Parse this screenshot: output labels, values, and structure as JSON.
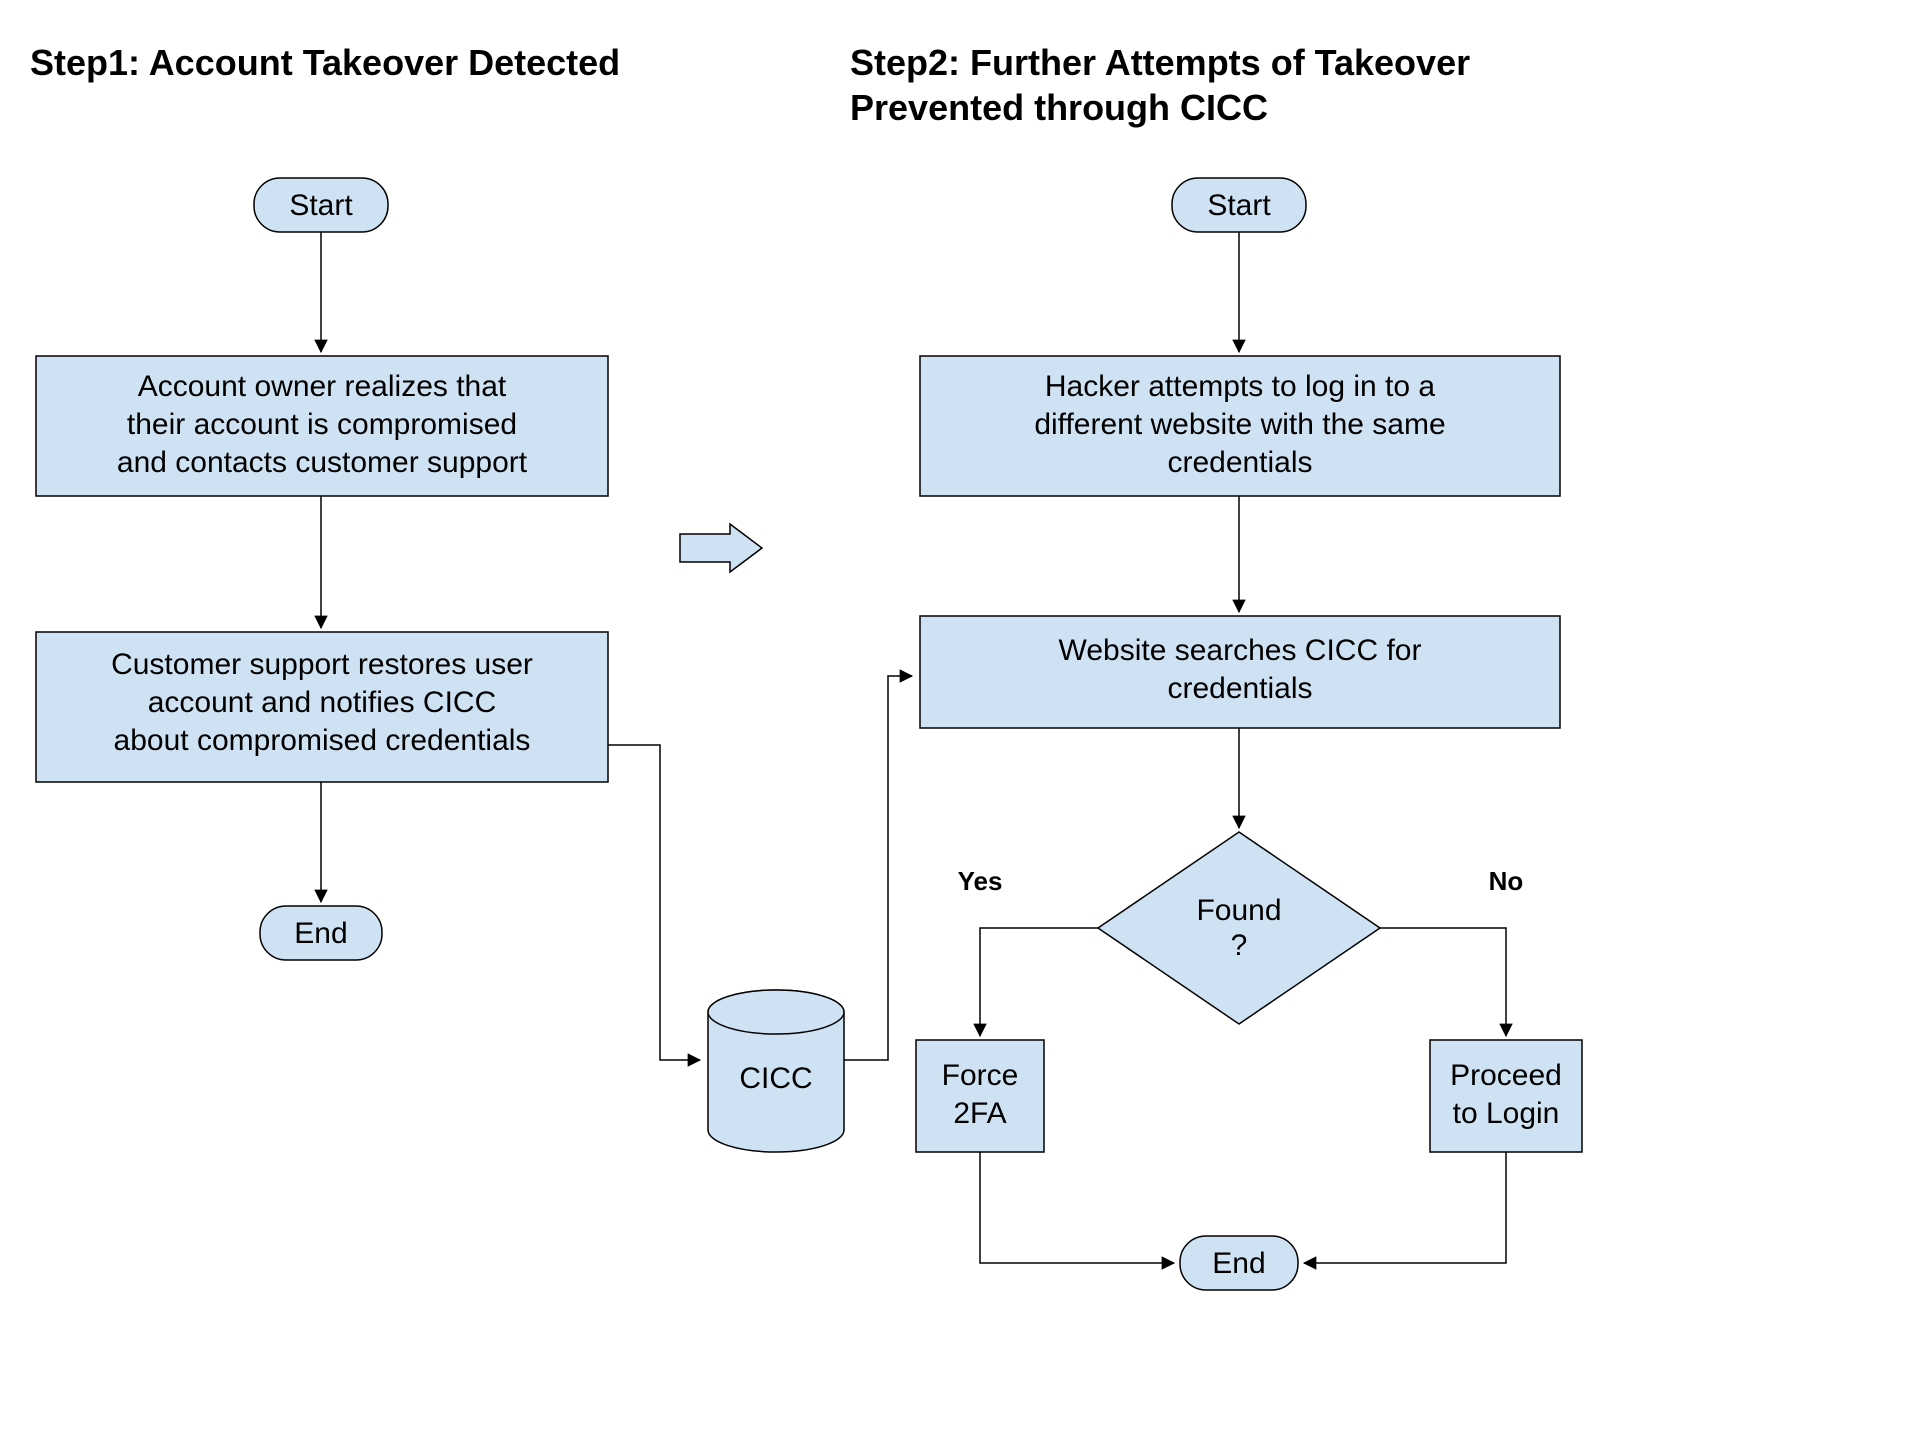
{
  "step1": {
    "title": "Step1: Account Takeover Detected",
    "start": "Start",
    "box1_l1": "Account owner realizes that",
    "box1_l2": "their account is compromised",
    "box1_l3": "and contacts customer support",
    "box2_l1": "Customer support restores user",
    "box2_l2": "account and notifies CICC",
    "box2_l3": "about compromised credentials",
    "end": "End"
  },
  "step2": {
    "title_l1": "Step2: Further Attempts of Takeover",
    "title_l2": "Prevented through CICC",
    "start": "Start",
    "box1_l1": "Hacker attempts to log in to a",
    "box1_l2": "different website with the same",
    "box1_l3": "credentials",
    "box2_l1": "Website searches CICC for",
    "box2_l2": "credentials",
    "decision_l1": "Found",
    "decision_l2": "?",
    "yes": "Yes",
    "no": "No",
    "force_l1": "Force",
    "force_l2": "2FA",
    "proceed_l1": "Proceed",
    "proceed_l2": "to Login",
    "end": "End"
  },
  "db": "CICC",
  "colors": {
    "fill": "#cfe2f3",
    "stroke": "#000000"
  }
}
